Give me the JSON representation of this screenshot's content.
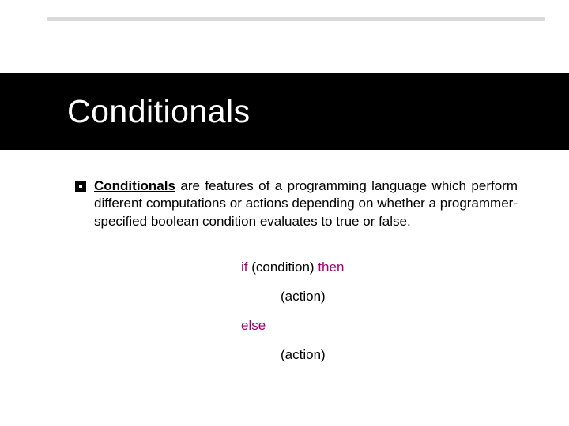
{
  "title": "Conditionals",
  "bullet": {
    "keyword": "Conditionals",
    "rest": " are features of a programming language which perform different computations or actions depending on whether a programmer-specified boolean condition evaluates to true or false."
  },
  "code": {
    "kw_if": "if",
    "cond": " (condition) ",
    "kw_then": "then",
    "action1": "(action)",
    "kw_else": "else",
    "action2": "(action)"
  }
}
